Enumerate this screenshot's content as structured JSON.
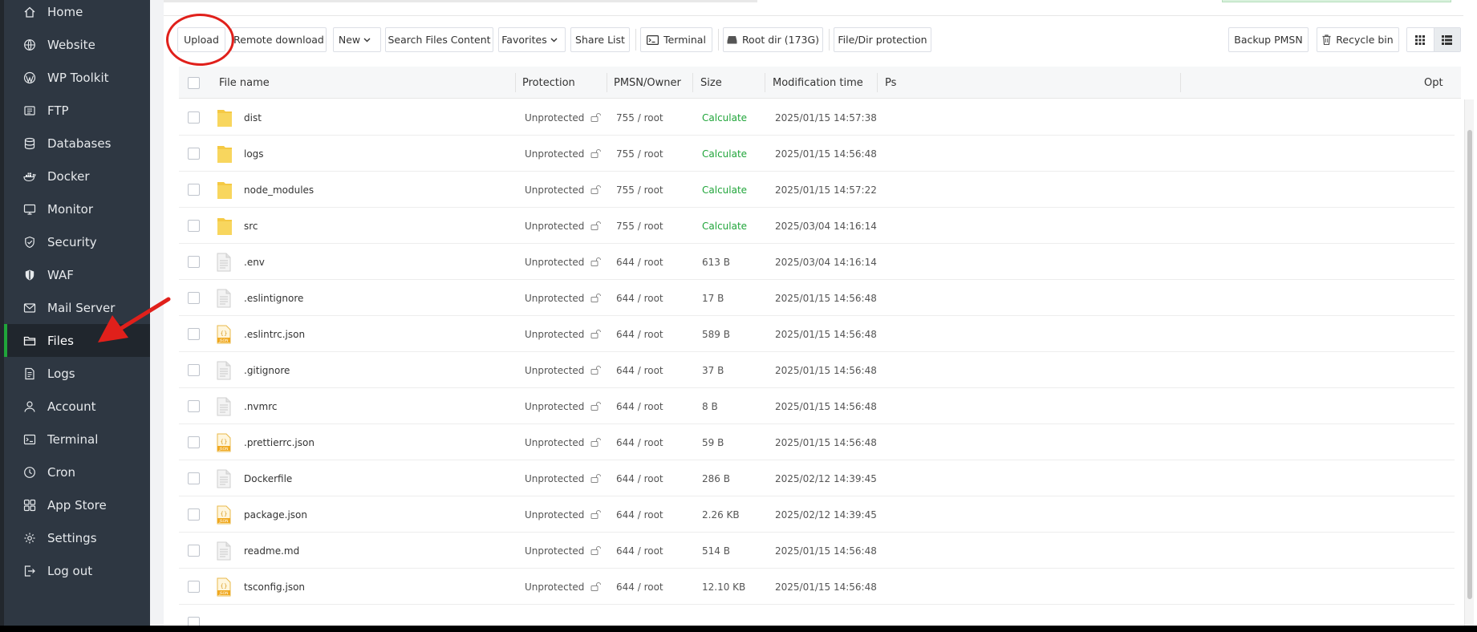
{
  "sidebar": {
    "items": [
      {
        "label": "Home",
        "icon": "home-icon",
        "active": false
      },
      {
        "label": "Website",
        "icon": "globe-icon",
        "active": false
      },
      {
        "label": "WP Toolkit",
        "icon": "wordpress-icon",
        "active": false
      },
      {
        "label": "FTP",
        "icon": "ftp-icon",
        "active": false
      },
      {
        "label": "Databases",
        "icon": "database-icon",
        "active": false
      },
      {
        "label": "Docker",
        "icon": "docker-icon",
        "active": false
      },
      {
        "label": "Monitor",
        "icon": "monitor-icon",
        "active": false
      },
      {
        "label": "Security",
        "icon": "shield-icon",
        "active": false
      },
      {
        "label": "WAF",
        "icon": "waf-shield-icon",
        "active": false
      },
      {
        "label": "Mail Server",
        "icon": "mail-icon",
        "active": false
      },
      {
        "label": "Files",
        "icon": "folder-icon",
        "active": true
      },
      {
        "label": "Logs",
        "icon": "logs-icon",
        "active": false
      },
      {
        "label": "Account",
        "icon": "user-icon",
        "active": false
      },
      {
        "label": "Terminal",
        "icon": "terminal-icon",
        "active": false
      },
      {
        "label": "Cron",
        "icon": "clock-icon",
        "active": false
      },
      {
        "label": "App Store",
        "icon": "apps-icon",
        "active": false
      },
      {
        "label": "Settings",
        "icon": "gear-icon",
        "active": false
      },
      {
        "label": "Log out",
        "icon": "logout-icon",
        "active": false
      }
    ]
  },
  "toolbar": {
    "upload": "Upload",
    "remote_download": "Remote download",
    "new": "New",
    "search_files_content": "Search Files Content",
    "favorites": "Favorites",
    "share_list": "Share List",
    "terminal": "Terminal",
    "root_dir": "Root dir (173G)",
    "file_dir_protection": "File/Dir protection",
    "backup": "Backup PMSN",
    "recycle_bin": "Recycle bin"
  },
  "table": {
    "headers": {
      "file_name": "File name",
      "protection": "Protection",
      "owner": "PMSN/Owner",
      "size": "Size",
      "mtime": "Modification time",
      "ps": "Ps",
      "opt": "Opt"
    },
    "rows": [
      {
        "name": "dist",
        "type": "folder",
        "protection": "Unprotected",
        "owner": "755 / root",
        "size": "Calculate",
        "mtime": "2025/01/15 14:57:38"
      },
      {
        "name": "logs",
        "type": "folder",
        "protection": "Unprotected",
        "owner": "755 / root",
        "size": "Calculate",
        "mtime": "2025/01/15 14:56:48"
      },
      {
        "name": "node_modules",
        "type": "folder",
        "protection": "Unprotected",
        "owner": "755 / root",
        "size": "Calculate",
        "mtime": "2025/01/15 14:57:22"
      },
      {
        "name": "src",
        "type": "folder",
        "protection": "Unprotected",
        "owner": "755 / root",
        "size": "Calculate",
        "mtime": "2025/03/04 14:16:14"
      },
      {
        "name": ".env",
        "type": "file",
        "protection": "Unprotected",
        "owner": "644 / root",
        "size": "613 B",
        "mtime": "2025/03/04 14:16:14"
      },
      {
        "name": ".eslintignore",
        "type": "file",
        "protection": "Unprotected",
        "owner": "644 / root",
        "size": "17 B",
        "mtime": "2025/01/15 14:56:48"
      },
      {
        "name": ".eslintrc.json",
        "type": "json",
        "protection": "Unprotected",
        "owner": "644 / root",
        "size": "589 B",
        "mtime": "2025/01/15 14:56:48"
      },
      {
        "name": ".gitignore",
        "type": "file",
        "protection": "Unprotected",
        "owner": "644 / root",
        "size": "37 B",
        "mtime": "2025/01/15 14:56:48"
      },
      {
        "name": ".nvmrc",
        "type": "file",
        "protection": "Unprotected",
        "owner": "644 / root",
        "size": "8 B",
        "mtime": "2025/01/15 14:56:48"
      },
      {
        "name": ".prettierrc.json",
        "type": "json",
        "protection": "Unprotected",
        "owner": "644 / root",
        "size": "59 B",
        "mtime": "2025/01/15 14:56:48"
      },
      {
        "name": "Dockerfile",
        "type": "file",
        "protection": "Unprotected",
        "owner": "644 / root",
        "size": "286 B",
        "mtime": "2025/02/12 14:39:45"
      },
      {
        "name": "package.json",
        "type": "json",
        "protection": "Unprotected",
        "owner": "644 / root",
        "size": "2.26 KB",
        "mtime": "2025/02/12 14:39:45"
      },
      {
        "name": "readme.md",
        "type": "file",
        "protection": "Unprotected",
        "owner": "644 / root",
        "size": "514 B",
        "mtime": "2025/01/15 14:56:48"
      },
      {
        "name": "tsconfig.json",
        "type": "json",
        "protection": "Unprotected",
        "owner": "644 / root",
        "size": "12.10 KB",
        "mtime": "2025/01/15 14:56:48"
      }
    ]
  },
  "colors": {
    "sidebar_bg": "#2e3742",
    "accent_green": "#20a53a",
    "annotation_red": "#e0201b",
    "folder_yellow": "#f5c944"
  }
}
